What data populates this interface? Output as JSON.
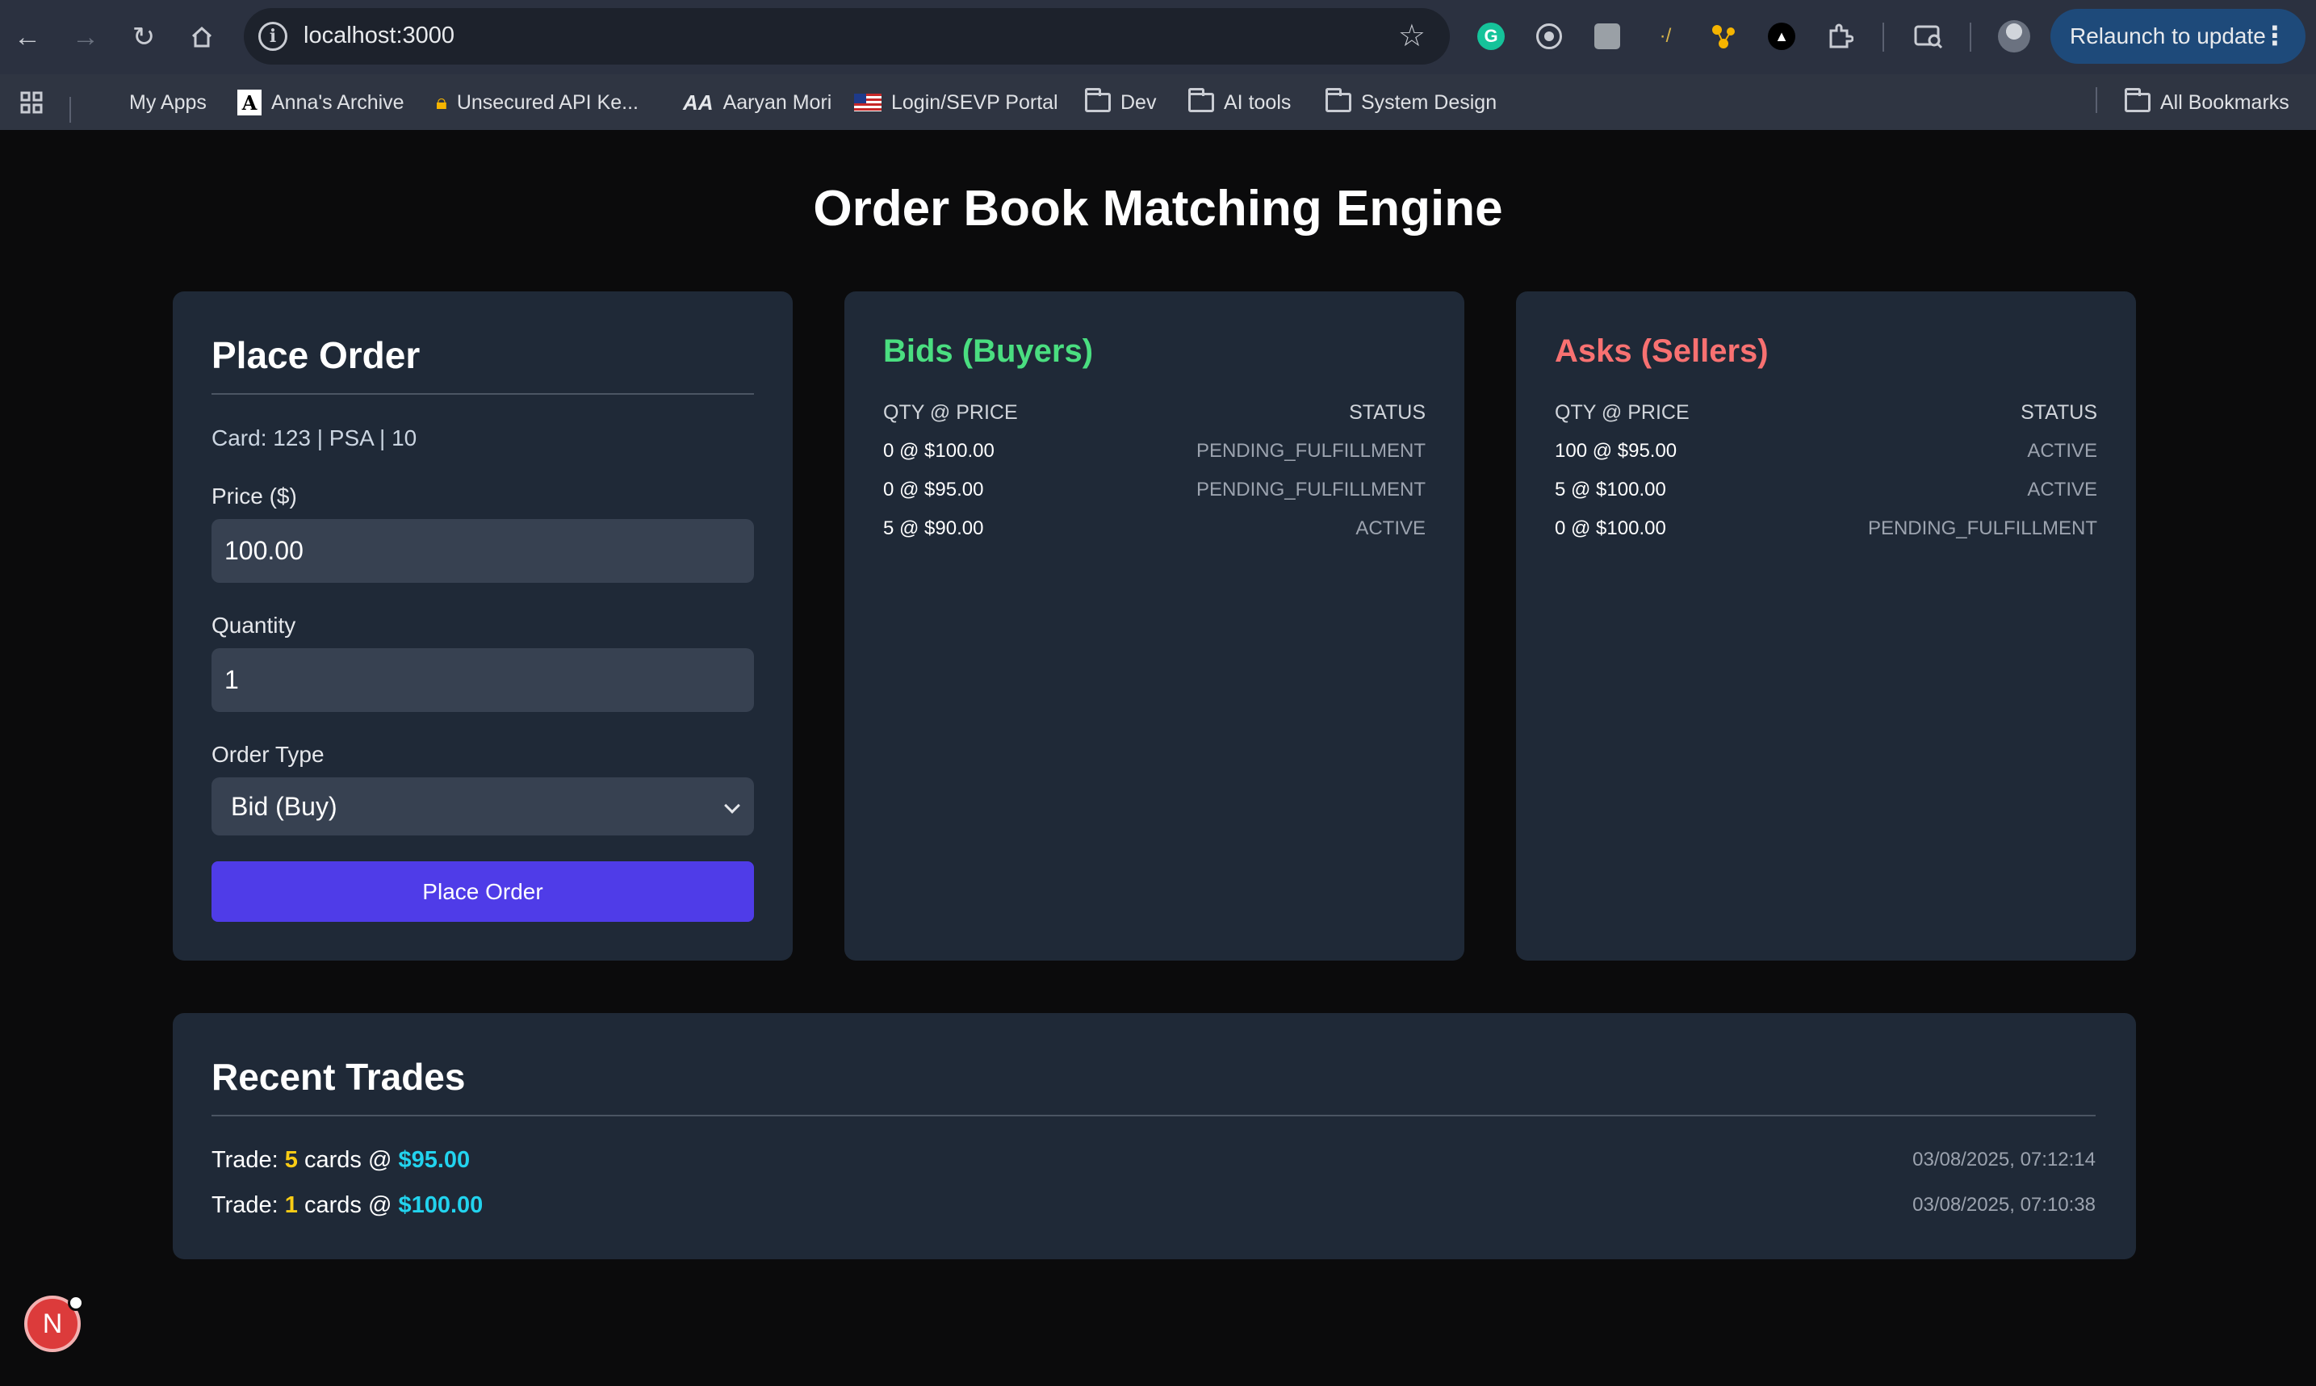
{
  "browser": {
    "url": "localhost:3000",
    "relaunch_label": "Relaunch to update",
    "bookmarks": [
      {
        "label": "My Apps",
        "icon": "microsoft-icon"
      },
      {
        "label": "Anna's Archive",
        "icon": "annas-archive-icon"
      },
      {
        "label": "Unsecured API Ke...",
        "icon": "lock-icon"
      },
      {
        "label": "Aaryan Mori",
        "icon": "aa-icon"
      },
      {
        "label": "Login/SEVP Portal",
        "icon": "us-flag-icon"
      },
      {
        "label": "Dev",
        "icon": "folder-icon"
      },
      {
        "label": "AI tools",
        "icon": "folder-icon"
      },
      {
        "label": "System Design",
        "icon": "folder-icon"
      }
    ],
    "all_bookmarks": "All Bookmarks"
  },
  "page": {
    "title": "Order Book Matching Engine"
  },
  "place_order": {
    "title": "Place Order",
    "card_info": "Card: 123 | PSA | 10",
    "price_label": "Price ($)",
    "price_value": "100.00",
    "quantity_label": "Quantity",
    "quantity_value": "1",
    "order_type_label": "Order Type",
    "order_type_value": "Bid (Buy)",
    "submit_label": "Place Order"
  },
  "bids": {
    "title": "Bids (Buyers)",
    "color": "#4ade80",
    "col_left": "QTY @ PRICE",
    "col_right": "STATUS",
    "rows": [
      {
        "order": "0 @ $100.00",
        "status": "PENDING_FULFILLMENT"
      },
      {
        "order": "0 @ $95.00",
        "status": "PENDING_FULFILLMENT"
      },
      {
        "order": "5 @ $90.00",
        "status": "ACTIVE"
      }
    ]
  },
  "asks": {
    "title": "Asks (Sellers)",
    "color": "#f87171",
    "col_left": "QTY @ PRICE",
    "col_right": "STATUS",
    "rows": [
      {
        "order": "100 @ $95.00",
        "status": "ACTIVE"
      },
      {
        "order": "5 @ $100.00",
        "status": "ACTIVE"
      },
      {
        "order": "0 @ $100.00",
        "status": "PENDING_FULFILLMENT"
      }
    ]
  },
  "recent_trades": {
    "title": "Recent Trades",
    "trades": [
      {
        "prefix": "Trade: ",
        "qty": "5",
        "middle": " cards @ ",
        "price": "$95.00",
        "timestamp": "03/08/2025, 07:12:14"
      },
      {
        "prefix": "Trade: ",
        "qty": "1",
        "middle": " cards @ ",
        "price": "$100.00",
        "timestamp": "03/08/2025, 07:10:38"
      }
    ]
  },
  "dev_badge": "N"
}
